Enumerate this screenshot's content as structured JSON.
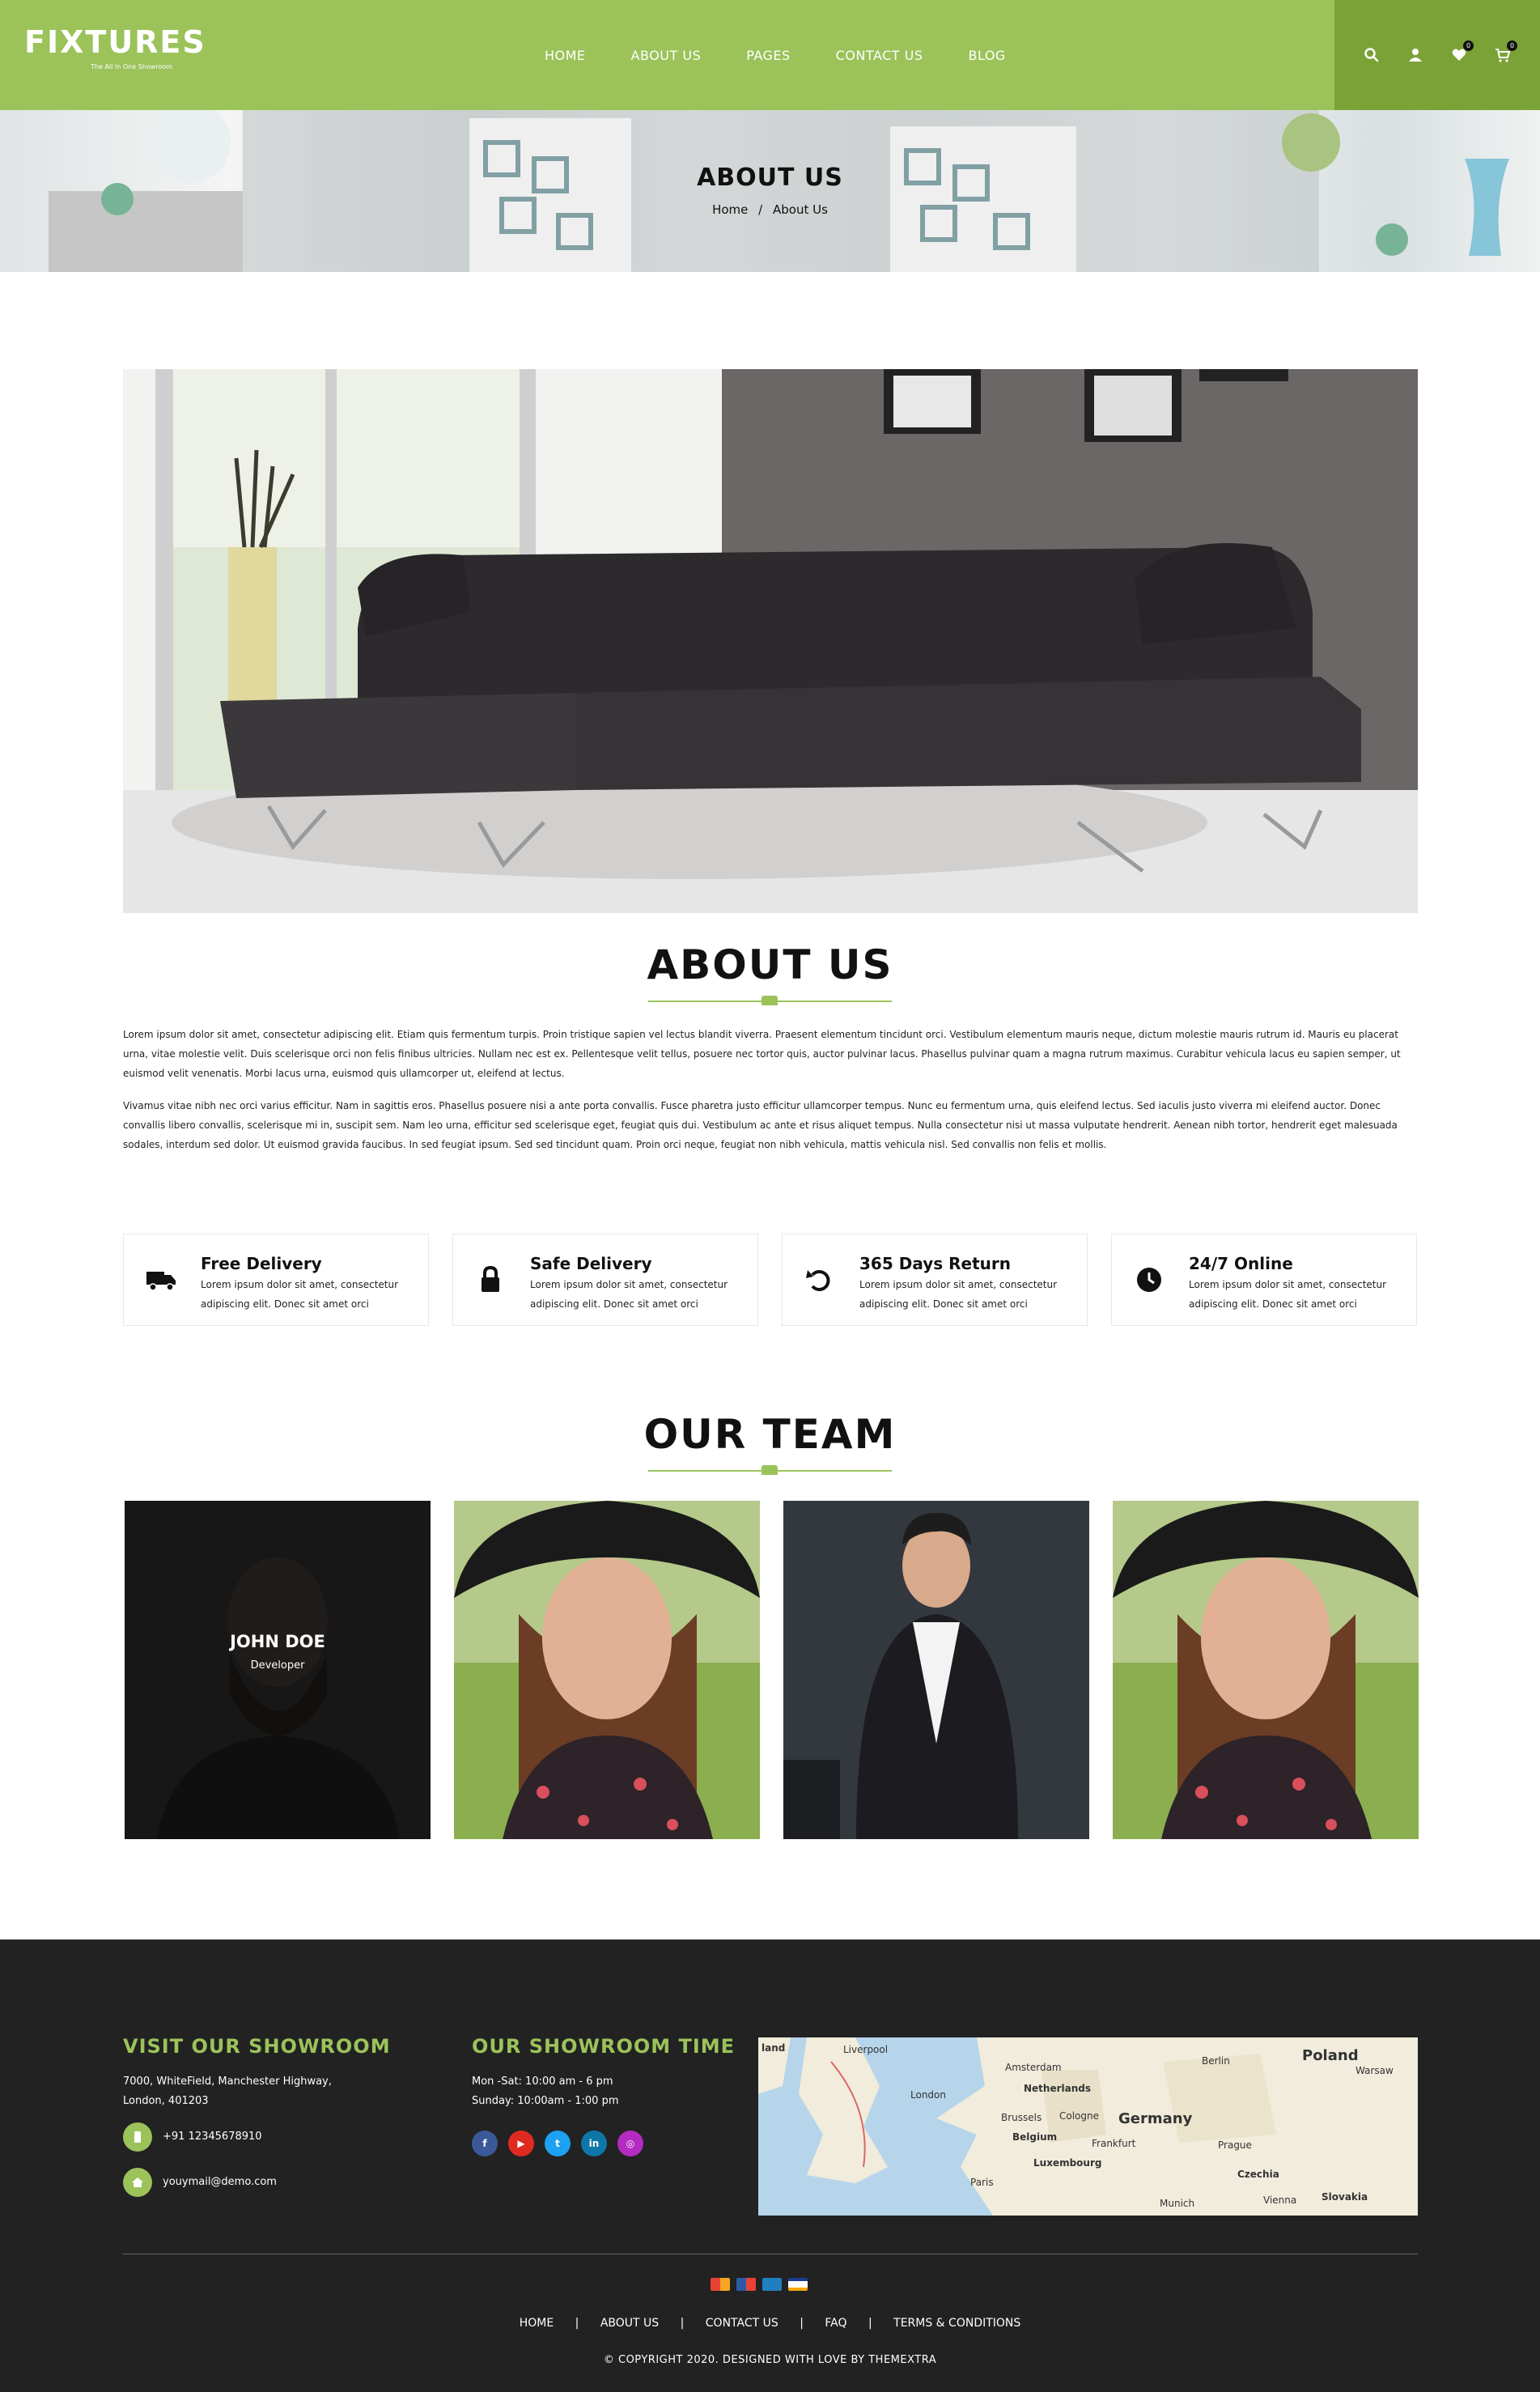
{
  "header": {
    "logo_text": "FIXTURES",
    "logo_tagline": "The All In One Showroom",
    "nav": [
      "HOME",
      "ABOUT US",
      "PAGES",
      "CONTACT US",
      "BLOG"
    ],
    "wishlist_count": "0",
    "cart_count": "0",
    "colors": {
      "bar": "#9bc35a",
      "icon_panel": "#7aa237"
    }
  },
  "banner": {
    "title": "ABOUT US",
    "breadcrumb_home": "Home",
    "breadcrumb_sep": "/",
    "breadcrumb_current": "About Us"
  },
  "about": {
    "title": "ABOUT US",
    "paragraph1": "Lorem ipsum dolor sit amet, consectetur adipiscing elit. Etiam quis fermentum turpis. Proin tristique sapien vel lectus blandit viverra. Praesent elementum tincidunt orci. Vestibulum elementum mauris neque, dictum molestie mauris rutrum id. Mauris eu placerat urna, vitae molestie velit. Duis scelerisque orci non felis finibus ultricies. Nullam nec est ex. Pellentesque velit tellus, posuere nec tortor quis, auctor pulvinar lacus. Phasellus pulvinar quam a magna rutrum maximus. Curabitur vehicula lacus eu sapien semper, ut euismod velit venenatis. Morbi lacus urna, euismod quis ullamcorper ut, eleifend at lectus.",
    "paragraph2": "Vivamus vitae nibh nec orci varius efficitur. Nam in sagittis eros. Phasellus posuere nisi a ante porta convallis. Fusce pharetra justo efficitur ullamcorper tempus. Nunc eu fermentum urna, quis eleifend lectus. Sed iaculis justo viverra mi eleifend auctor. Donec convallis libero convallis, scelerisque mi in, suscipit sem. Nam leo urna, efficitur sed scelerisque eget, feugiat quis dui. Vestibulum ac ante et risus aliquet tempus. Nulla consectetur nisi ut massa vulputate hendrerit. Aenean nibh tortor, hendrerit eget malesuada sodales, interdum sed dolor. Ut euismod gravida faucibus. In sed feugiat ipsum. Sed sed tincidunt quam. Proin orci neque, feugiat non nibh vehicula, mattis vehicula nisl. Sed convallis non felis et mollis."
  },
  "features": [
    {
      "icon": "truck-icon",
      "title": "Free Delivery",
      "desc": "Lorem ipsum dolor sit amet, consectetur adipiscing elit. Donec sit amet orci"
    },
    {
      "icon": "lock-icon",
      "title": "Safe Delivery",
      "desc": "Lorem ipsum dolor sit amet, consectetur adipiscing elit. Donec sit amet orci"
    },
    {
      "icon": "return-icon",
      "title": "365 Days Return",
      "desc": "Lorem ipsum dolor sit amet, consectetur adipiscing elit. Donec sit amet orci"
    },
    {
      "icon": "clock-icon",
      "title": "24/7 Online",
      "desc": "Lorem ipsum dolor sit amet, consectetur adipiscing elit. Donec sit amet orci"
    }
  ],
  "team": {
    "title": "OUR TEAM",
    "members": [
      {
        "name": "JOHN DOE",
        "role": "Developer"
      }
    ]
  },
  "footer": {
    "showroom_title": "VISIT OUR SHOWROOM",
    "address_line1": "7000, WhiteField, Manchester Highway,",
    "address_line2": "London, 401203",
    "phone": "+91 12345678910",
    "email": "youymail@demo.com",
    "time_title": "OUR SHOWROOM TIME",
    "hours_weekday": "Mon -Sat: 10:00 am - 6 pm",
    "hours_sunday": "Sunday: 10:00am - 1:00 pm",
    "social": [
      "facebook-icon",
      "youtube-icon",
      "twitter-icon",
      "linkedin-icon",
      "instagram-icon"
    ],
    "map_labels": [
      "land",
      "Liverpool",
      "London",
      "Amsterdam",
      "Netherlands",
      "Brussels",
      "Cologne",
      "Belgium",
      "Luxembourg",
      "Germany",
      "Frankfurt",
      "Berlin",
      "Poland",
      "Warsaw",
      "Prague",
      "Czechia",
      "Paris",
      "Munich",
      "Vienna",
      "Slovakia"
    ],
    "nav": [
      "HOME",
      "ABOUT US",
      "CONTACT US",
      "FAQ",
      "TERMS & CONDITIONS"
    ],
    "nav_sep": "|",
    "copyright": "© COPYRIGHT 2020. DESIGNED WITH LOVE BY THEMEXTRA"
  }
}
